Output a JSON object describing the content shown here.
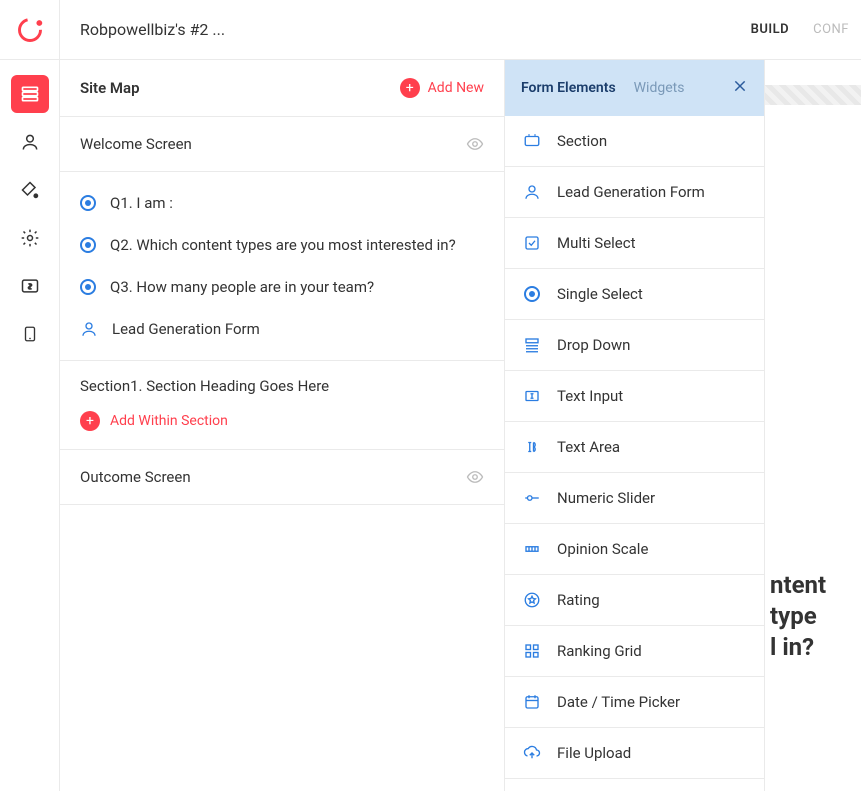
{
  "header": {
    "title": "Robpowellbiz's #2 ...",
    "nav": {
      "build": "BUILD",
      "conf": "CONF"
    }
  },
  "rail": {
    "items": [
      {
        "name": "sitemap-icon"
      },
      {
        "name": "person-icon"
      },
      {
        "name": "paint-icon"
      },
      {
        "name": "gear-icon"
      },
      {
        "name": "price-icon"
      },
      {
        "name": "device-icon"
      }
    ]
  },
  "sitemap": {
    "title": "Site Map",
    "add_new": "Add New",
    "welcome_label": "Welcome Screen",
    "questions": [
      {
        "label": "Q1. I am :"
      },
      {
        "label": "Q2. Which content types are you most interested in?"
      },
      {
        "label": "Q3. How many people are in your team?"
      }
    ],
    "lead_form_label": "Lead Generation Form",
    "section_heading": "Section1. Section Heading Goes Here",
    "add_within": "Add Within Section",
    "outcome_label": "Outcome Screen"
  },
  "elements_panel": {
    "tabs": {
      "form_elements": "Form Elements",
      "widgets": "Widgets"
    },
    "items": [
      {
        "icon": "section-icon",
        "label": "Section"
      },
      {
        "icon": "leadform-icon",
        "label": "Lead Generation Form"
      },
      {
        "icon": "multiselect-icon",
        "label": "Multi Select"
      },
      {
        "icon": "singleselect-icon",
        "label": "Single Select"
      },
      {
        "icon": "dropdown-icon",
        "label": "Drop Down"
      },
      {
        "icon": "textinput-icon",
        "label": "Text Input"
      },
      {
        "icon": "textarea-icon",
        "label": "Text Area"
      },
      {
        "icon": "slider-icon",
        "label": "Numeric Slider"
      },
      {
        "icon": "scale-icon",
        "label": "Opinion Scale"
      },
      {
        "icon": "rating-icon",
        "label": "Rating"
      },
      {
        "icon": "rankgrid-icon",
        "label": "Ranking Grid"
      },
      {
        "icon": "datetime-icon",
        "label": "Date / Time Picker"
      },
      {
        "icon": "fileupload-icon",
        "label": "File Upload"
      }
    ]
  },
  "preview": {
    "line1": "ntent type",
    "line2": "l in?"
  }
}
